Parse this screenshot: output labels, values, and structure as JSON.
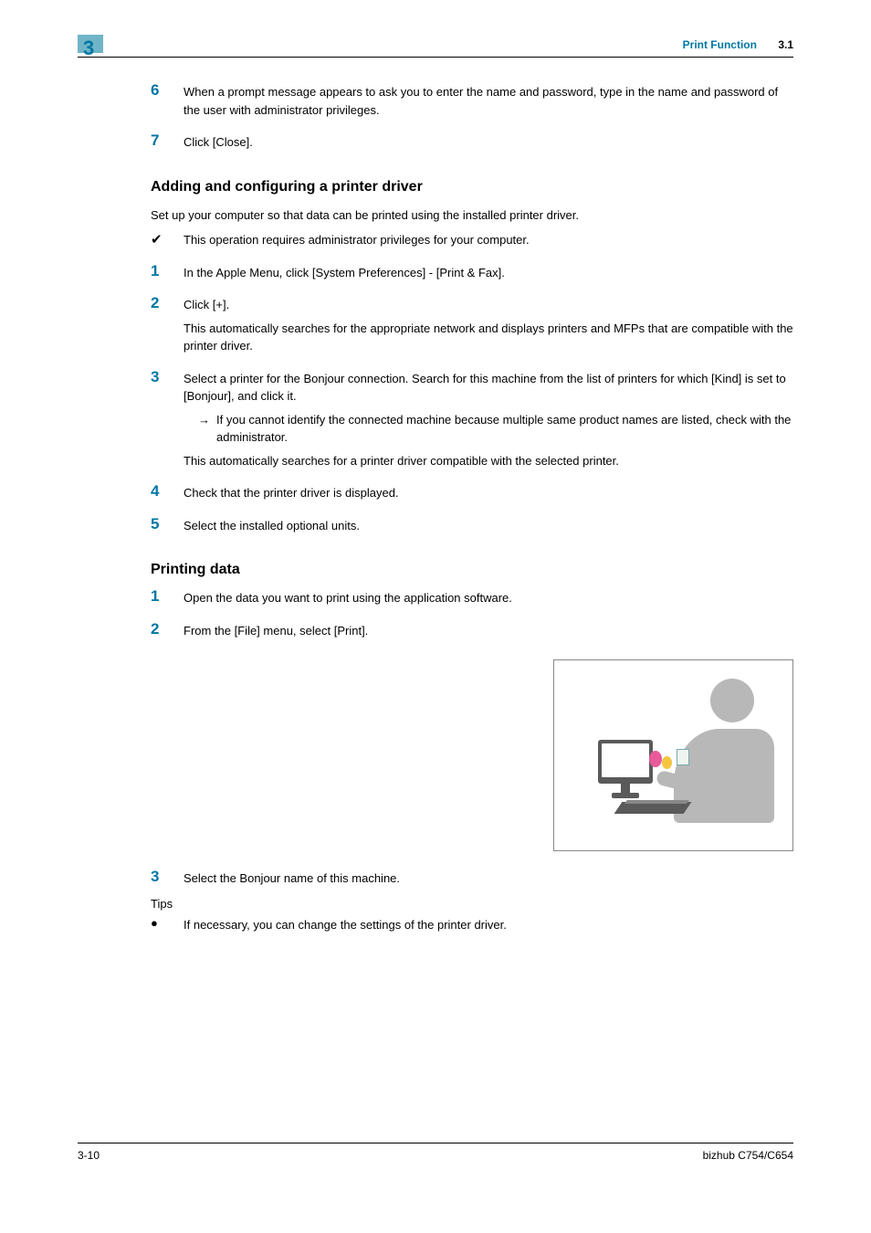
{
  "header": {
    "chapter_number": "3",
    "title": "Print Function",
    "section_number": "3.1"
  },
  "continued_steps": [
    {
      "num": "6",
      "text": "When a prompt message appears to ask you to enter the name and password, type in the name and password of the user with administrator privileges."
    },
    {
      "num": "7",
      "text": "Click [Close]."
    }
  ],
  "section_a": {
    "heading": "Adding and configuring a printer driver",
    "intro": "Set up your computer so that data can be printed using the installed printer driver.",
    "note_check": "This operation requires administrator privileges for your computer.",
    "steps": [
      {
        "num": "1",
        "text": "In the Apple Menu, click [System Preferences] - [Print & Fax]."
      },
      {
        "num": "2",
        "text": "Click [+].",
        "cont": "This automatically searches for the appropriate network and displays printers and MFPs that are compatible with the printer driver."
      },
      {
        "num": "3",
        "text": "Select a printer for the Bonjour connection. Search for this machine from the list of printers for which [Kind] is set to [Bonjour], and click it.",
        "sub": "If you cannot identify the connected machine because multiple same product names are listed, check with the administrator.",
        "cont2": "This automatically searches for a printer driver compatible with the selected printer."
      },
      {
        "num": "4",
        "text": "Check that the printer driver is displayed."
      },
      {
        "num": "5",
        "text": "Select the installed optional units."
      }
    ]
  },
  "section_b": {
    "heading": "Printing data",
    "steps": [
      {
        "num": "1",
        "text": "Open the data you want to print using the application software."
      },
      {
        "num": "2",
        "text": "From the [File] menu, select [Print]."
      },
      {
        "num": "3",
        "text": "Select the Bonjour name of this machine."
      }
    ],
    "tips_label": "Tips",
    "tip_bullet": "If necessary, you can change the settings of the printer driver."
  },
  "footer": {
    "page_number": "3-10",
    "product": "bizhub C754/C654"
  }
}
